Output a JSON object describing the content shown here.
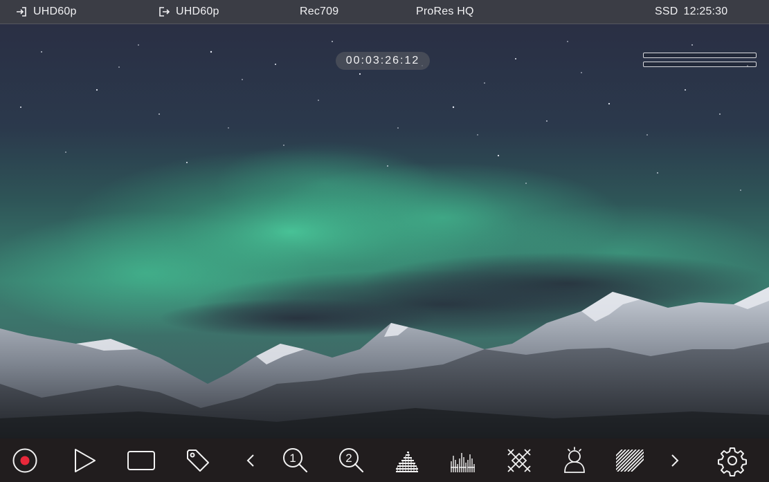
{
  "status_bar": {
    "input_format": "UHD60p",
    "output_format": "UHD60p",
    "gamma": "Rec709",
    "codec": "ProRes HQ",
    "media_type": "SSD",
    "remaining_time": "12:25:30"
  },
  "timecode": "00:03:26:12",
  "audio_meters": {
    "channel_1_level": 0,
    "channel_2_level": 0
  },
  "toolbar": {
    "buttons": [
      {
        "name": "record",
        "icon": "record-icon"
      },
      {
        "name": "play",
        "icon": "play-icon"
      },
      {
        "name": "aspect-frame",
        "icon": "frame-guide-icon"
      },
      {
        "name": "tag",
        "icon": "tag-icon"
      },
      {
        "name": "previous-page",
        "icon": "chevron-left-icon"
      },
      {
        "name": "zoom-1",
        "icon": "zoom-1-icon"
      },
      {
        "name": "zoom-2",
        "icon": "zoom-2-icon"
      },
      {
        "name": "waveform",
        "icon": "waveform-icon"
      },
      {
        "name": "rgb-parade",
        "icon": "rgb-parade-icon"
      },
      {
        "name": "focus-peaking",
        "icon": "focus-peaking-icon"
      },
      {
        "name": "false-color",
        "icon": "false-color-icon"
      },
      {
        "name": "zebra",
        "icon": "zebra-icon"
      },
      {
        "name": "next-page",
        "icon": "chevron-right-icon"
      },
      {
        "name": "settings",
        "icon": "gear-icon"
      }
    ]
  },
  "colors": {
    "status_bar_bg": "#3b3d45",
    "toolbar_bg": "#211d1e",
    "record_red": "#e8283a",
    "icon_white": "#f2f2f2"
  }
}
